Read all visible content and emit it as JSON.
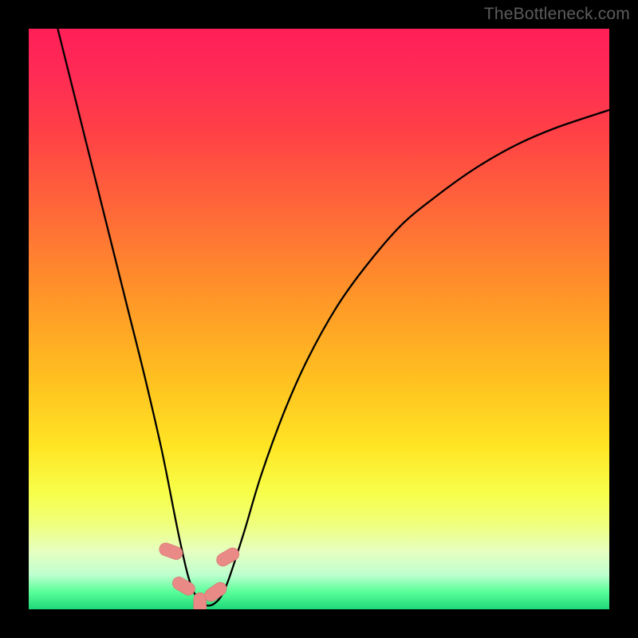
{
  "watermark": "TheBottleneck.com",
  "colors": {
    "frame": "#000000",
    "curve": "#000000",
    "marker_fill": "#e98a87",
    "marker_stroke": "#d86f6d",
    "gradient_top": "#ff1f57",
    "gradient_bottom": "#1fd879"
  },
  "chart_data": {
    "type": "line",
    "title": "",
    "xlabel": "",
    "ylabel": "",
    "xlim": [
      0,
      100
    ],
    "ylim": [
      0,
      100
    ],
    "grid": false,
    "legend": false,
    "note": "Axes are normalized 0–100. The curve plunges from top-left, reaches a flat minimum near x≈27–33 at y≈0, then rises with decreasing slope toward the top-right. Markers highlight the bottom of the dip.",
    "series": [
      {
        "name": "bottleneck-curve",
        "x": [
          5,
          8,
          11,
          14,
          17,
          20,
          23,
          26,
          28,
          30,
          32,
          34,
          37,
          40,
          44,
          48,
          53,
          58,
          64,
          70,
          77,
          84,
          91,
          100
        ],
        "y": [
          100,
          88,
          76,
          64,
          52,
          40,
          27,
          12,
          4,
          1,
          1,
          4,
          13,
          23,
          34,
          43,
          52,
          59,
          66,
          71,
          76,
          80,
          83,
          86
        ]
      }
    ],
    "markers": [
      {
        "x": 24.5,
        "y": 10,
        "rot": -70
      },
      {
        "x": 26.7,
        "y": 4,
        "rot": -60
      },
      {
        "x": 29.5,
        "y": 0.8,
        "rot": 0
      },
      {
        "x": 32.2,
        "y": 3,
        "rot": 55
      },
      {
        "x": 34.3,
        "y": 9,
        "rot": 60
      }
    ]
  }
}
